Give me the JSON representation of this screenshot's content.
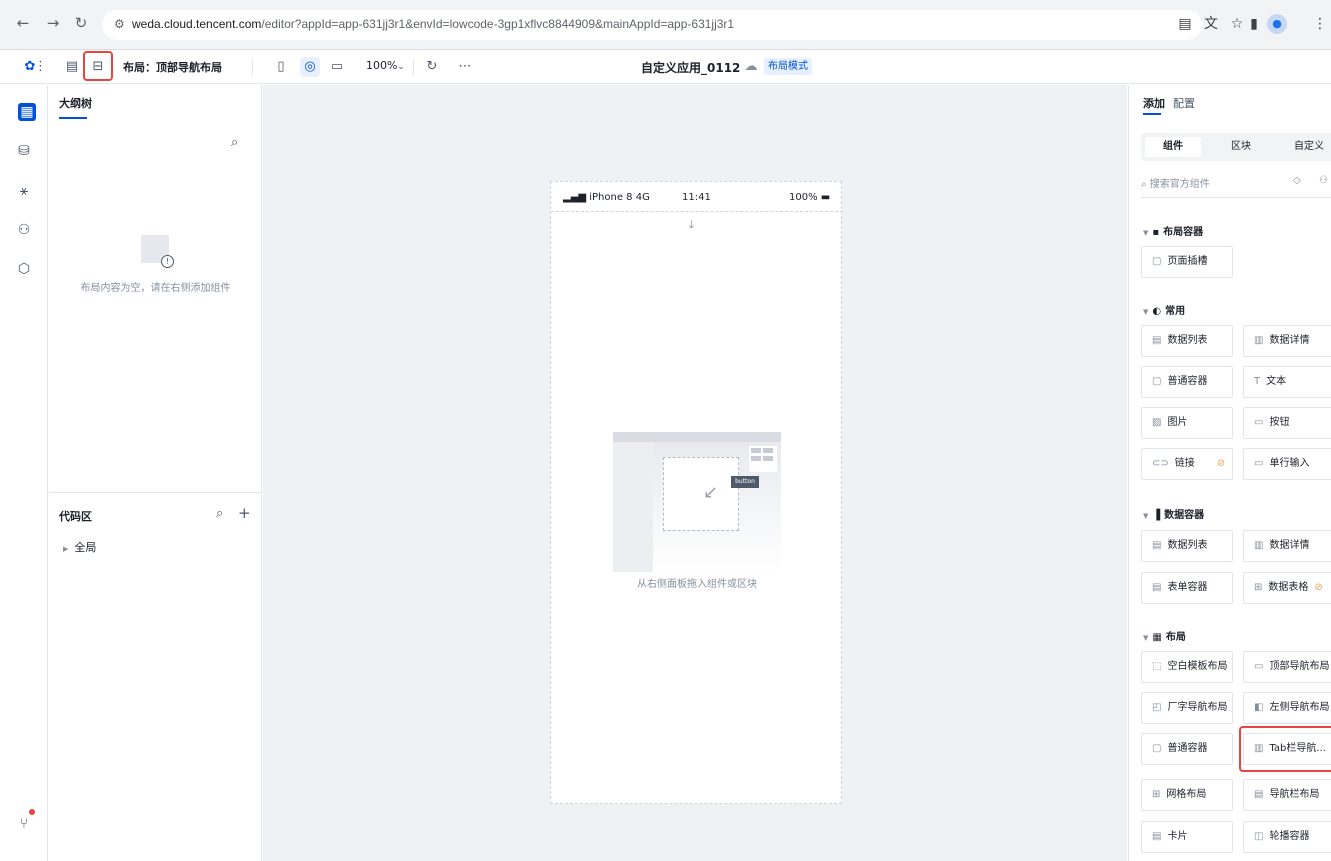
{
  "browser": {
    "url_host": "weda.cloud.tencent.com",
    "url_path": "/editor?appId=app-631jj3r1&envId=lowcode-3gp1xflvc8844909&mainAppId=app-631jj3r1"
  },
  "toolbar": {
    "layout_label": "布局：顶部导航布局",
    "zoom": "100%",
    "app_title": "自定义应用_0112",
    "mode_tag": "布局模式"
  },
  "outline": {
    "tab": "大纲树",
    "empty_text": "布局内容为空，请在右侧添加组件",
    "code_title": "代码区",
    "code_item": "全局"
  },
  "phone": {
    "carrier": "iPhone 8  4G",
    "time": "11:41",
    "battery": "100%",
    "illus_button": "button",
    "hint": "从右侧面板拖入组件或区块"
  },
  "right": {
    "tab_add": "添加",
    "tab_config": "配置",
    "seg": [
      "组件",
      "区块",
      "自定义"
    ],
    "search_placeholder": "搜索官方组件",
    "groups": {
      "layout_container": "布局容器",
      "common": "常用",
      "data_container": "数据容器",
      "layout": "布局"
    },
    "cards": {
      "page_slot": "页面插槽",
      "data_list": "数据列表",
      "data_detail": "数据详情",
      "normal_container": "普通容器",
      "text": "文本",
      "image": "图片",
      "button": "按钮",
      "link": "链接",
      "single_input": "单行输入",
      "data_list2": "数据列表",
      "data_detail2": "数据详情",
      "form_container": "表单容器",
      "data_table": "数据表格",
      "blank_template": "空白模板布局",
      "top_nav": "顶部导航布局",
      "l_nav": "厂字导航布局",
      "left_nav": "左侧导航布局",
      "normal_container2": "普通容器",
      "tab_nav": "Tab栏导航...",
      "grid": "网格布局",
      "navbar": "导航栏布局",
      "card": "卡片",
      "carousel": "轮播容器"
    }
  }
}
